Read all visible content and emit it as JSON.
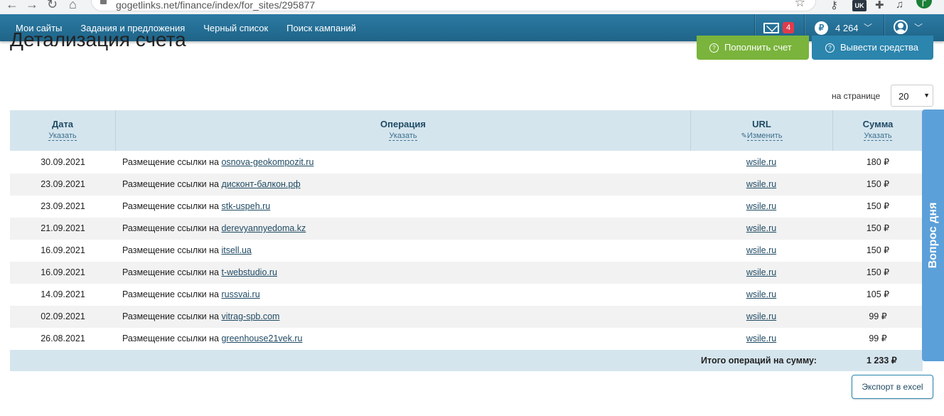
{
  "browser": {
    "url": "gogetlinks.net/finance/index/for_sites/295877",
    "ext_badge": "UK",
    "profile_initial": "Г"
  },
  "nav": {
    "items": [
      "Мои сайты",
      "Задания и предложения",
      "Черный список",
      "Поиск кампаний"
    ],
    "mail_count": "4",
    "currency_symbol": "₽",
    "balance": "4 264",
    "accent": "#2b7aa4"
  },
  "page": {
    "title": "Детализация счета",
    "btn_topup": "Пополнить счет",
    "btn_withdraw": "Вывести средства",
    "per_page_label": "на странице",
    "per_page_value": "20"
  },
  "table": {
    "headers": {
      "date": "Дата",
      "date_sub": "Указать",
      "op": "Операция",
      "op_sub": "Указать",
      "url": "URL",
      "url_sub": "Изменить",
      "sum": "Сумма",
      "sum_sub": "Указать"
    },
    "op_prefix": "Размещение ссылки на",
    "rows": [
      {
        "date": "30.09.2021",
        "site": "osnova-geokompozit.ru",
        "url": "wsile.ru",
        "sum": "180 ₽"
      },
      {
        "date": "23.09.2021",
        "site": "дисконт-балкон.рф",
        "url": "wsile.ru",
        "sum": "150 ₽"
      },
      {
        "date": "23.09.2021",
        "site": "stk-uspeh.ru",
        "url": "wsile.ru",
        "sum": "150 ₽"
      },
      {
        "date": "21.09.2021",
        "site": "derevyannyedoma.kz",
        "url": "wsile.ru",
        "sum": "150 ₽"
      },
      {
        "date": "16.09.2021",
        "site": "itsell.ua",
        "url": "wsile.ru",
        "sum": "150 ₽"
      },
      {
        "date": "16.09.2021",
        "site": "t-webstudio.ru",
        "url": "wsile.ru",
        "sum": "150 ₽"
      },
      {
        "date": "14.09.2021",
        "site": "russvai.ru",
        "url": "wsile.ru",
        "sum": "105 ₽"
      },
      {
        "date": "02.09.2021",
        "site": "vitrag-spb.com",
        "url": "wsile.ru",
        "sum": "99 ₽"
      },
      {
        "date": "26.08.2021",
        "site": "greenhouse21vek.ru",
        "url": "wsile.ru",
        "sum": "99 ₽"
      }
    ],
    "total_label": "Итого операций на сумму:",
    "total_value": "1 233 ₽"
  },
  "export_label": "Экспорт в excel",
  "side_tab": "Вопрос дня"
}
